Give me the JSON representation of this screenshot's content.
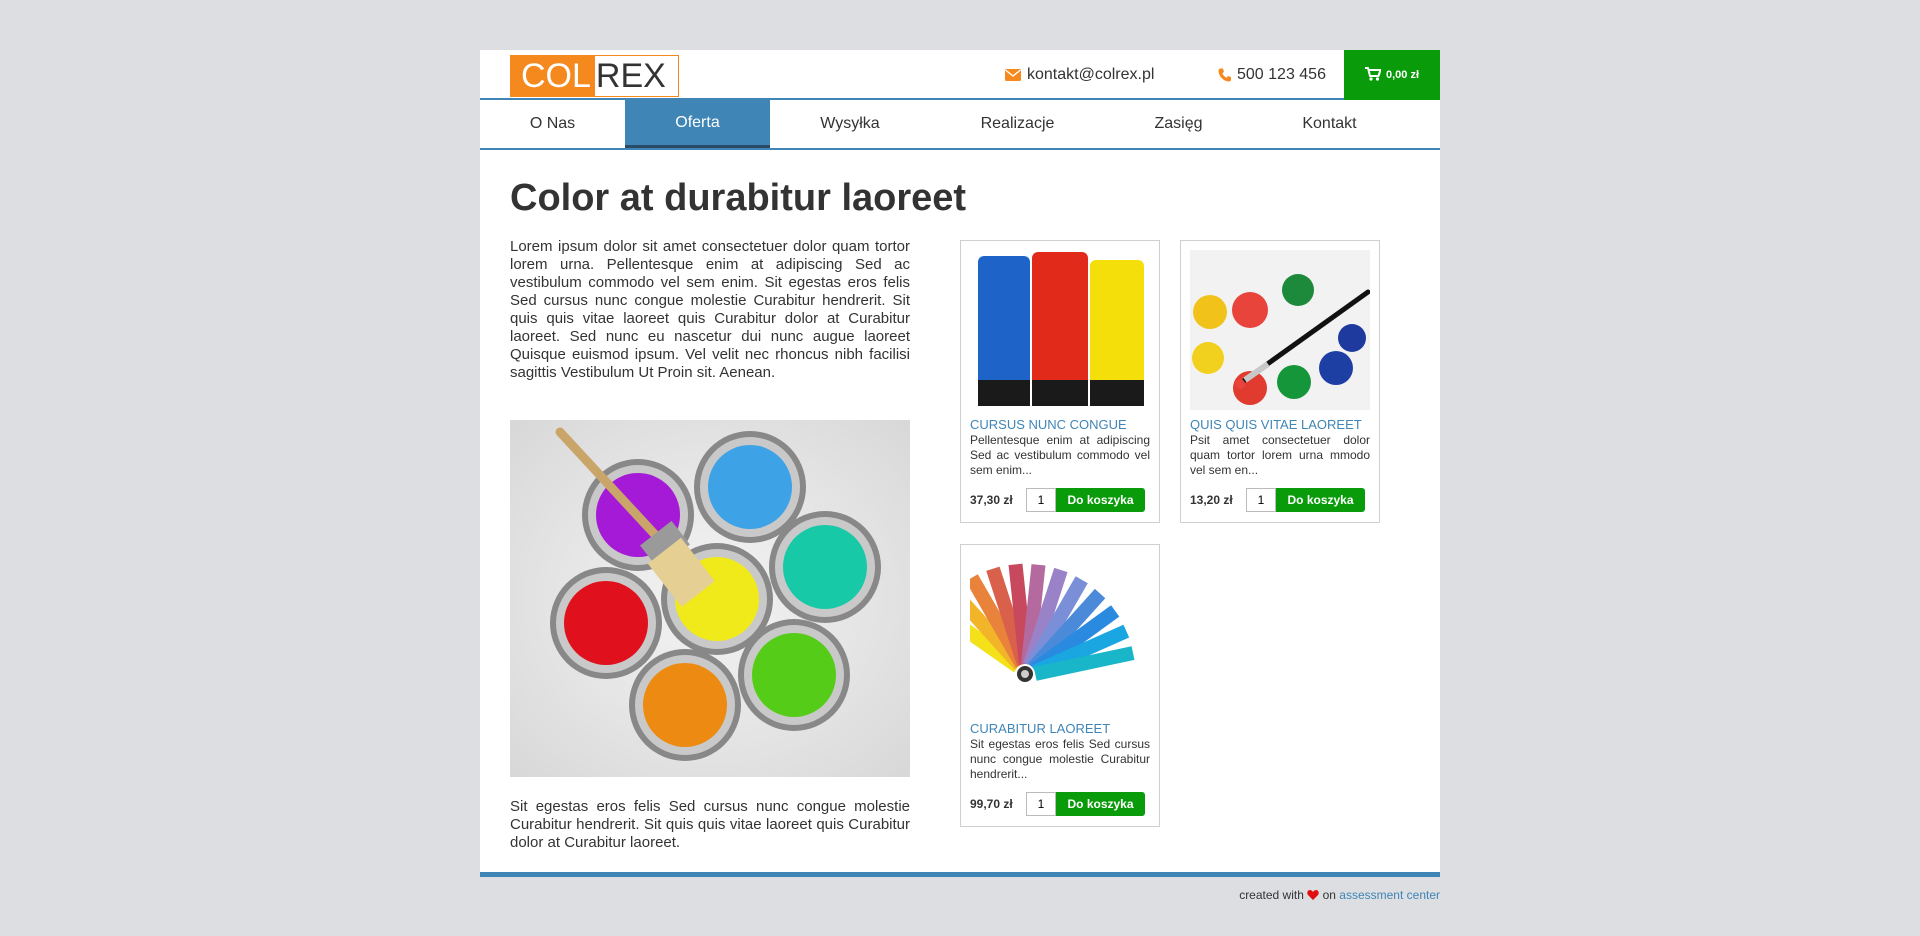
{
  "header": {
    "logo_left": "COL",
    "logo_right": "REX",
    "email": "kontakt@colrex.pl",
    "phone": "500 123 456",
    "cart_total": "0,00 zł"
  },
  "nav": {
    "items": [
      {
        "label": "O Nas"
      },
      {
        "label": "Oferta"
      },
      {
        "label": "Wysyłka"
      },
      {
        "label": "Realizacje"
      },
      {
        "label": "Zasięg"
      },
      {
        "label": "Kontakt"
      }
    ],
    "active": "Oferta"
  },
  "main": {
    "title": "Color at durabitur laoreet",
    "lead": "Lorem ipsum dolor sit amet consectetuer dolor quam tortor lorem urna. Pellentesque enim at adipiscing Sed ac vestibulum commodo vel sem enim. Sit egestas eros felis Sed cursus nunc congue molestie Curabitur hendrerit. Sit quis quis vitae laoreet quis Curabitur dolor at Curabitur laoreet. Sed nunc eu nascetur dui nunc augue laoreet Quisque euismod ipsum. Vel velit nec rhoncus nibh facilisi sagittis Vestibulum Ut Proin sit. Aenean.",
    "tail": "Sit egestas eros felis Sed cursus nunc congue molestie Curabitur hendrerit. Sit quis quis vitae laoreet quis Curabitur dolor at Curabitur laoreet."
  },
  "products": [
    {
      "title": "CURSUS NUNC CONGUE",
      "desc": "Pellentesque enim at adipiscing Sed ac vestibulum commodo vel sem enim...",
      "price": "37,30 zł",
      "qty": "1",
      "button": "Do koszyka"
    },
    {
      "title": "QUIS QUIS VITAE LAOREET",
      "desc": "Psit amet consectetuer dolor quam tortor lorem urna mmodo vel sem en...",
      "price": "13,20 zł",
      "qty": "1",
      "button": "Do koszyka"
    },
    {
      "title": "CURABITUR LAOREET",
      "desc": "Sit egestas eros felis Sed cursus nunc congue molestie Curabitur hendrerit...",
      "price": "99,70 zł",
      "qty": "1",
      "button": "Do koszyka"
    }
  ],
  "footer": {
    "created_with": "created with",
    "on": "on",
    "link": "assessment center"
  },
  "colors": {
    "accent": "#3f85b6",
    "logo_orange": "#f5891e",
    "buy_green": "#0a9b0a"
  },
  "icons": [
    "envelope-icon",
    "phone-icon",
    "cart-icon",
    "heart-icon"
  ]
}
